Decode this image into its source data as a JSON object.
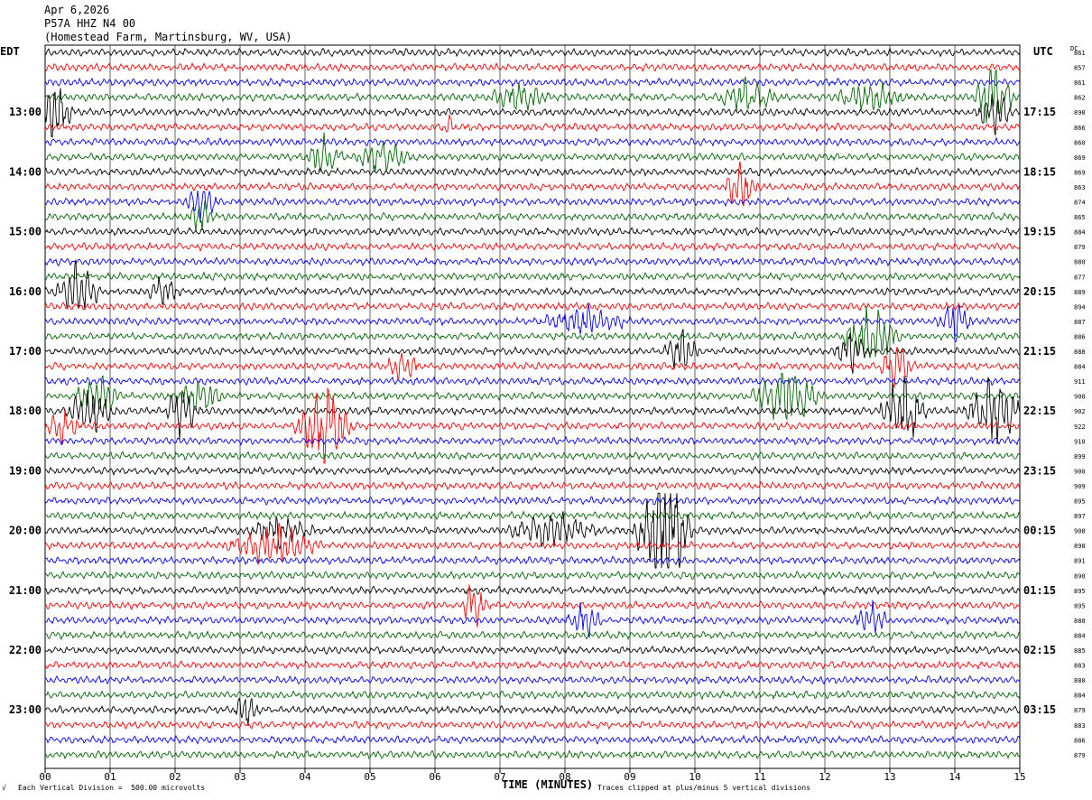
{
  "header": {
    "date": "Apr 6,2026",
    "station": "P57A HHZ N4 00",
    "location": "(Homestead Farm, Martinsburg, WV, USA)"
  },
  "left_tz": "EDT",
  "right_tz": "UTC",
  "dc_label": "DC",
  "footer": {
    "scale": "Each Vertical Division =  500.00 microvolts",
    "clip": "Traces clipped at plus/minus 5 vertical divisions",
    "mark": "√"
  },
  "colors": {
    "black": "#000000",
    "red": "#ff0000",
    "blue": "#0000ff",
    "green": "#006600",
    "grid": "#000000"
  },
  "chart_data": {
    "type": "line",
    "title": "",
    "xlabel": "TIME (MINUTES)",
    "x_ticks": [
      "00",
      "01",
      "02",
      "03",
      "04",
      "05",
      "06",
      "07",
      "08",
      "09",
      "10",
      "11",
      "12",
      "13",
      "14",
      "15"
    ],
    "xlim": [
      0,
      15
    ],
    "trace_colors": [
      "black",
      "red",
      "blue",
      "green"
    ],
    "left_hour_labels": [
      "13:00",
      "14:00",
      "15:00",
      "16:00",
      "17:00",
      "18:00",
      "19:00",
      "20:00",
      "21:00",
      "22:00",
      "23:00"
    ],
    "right_hour_labels": [
      "17:15",
      "18:15",
      "19:15",
      "20:15",
      "21:15",
      "22:15",
      "23:15",
      "00:15",
      "01:15",
      "02:15",
      "03:15"
    ],
    "dc_offsets": [
      861,
      857,
      861,
      862,
      890,
      866,
      860,
      869,
      869,
      863,
      874,
      865,
      884,
      879,
      880,
      877,
      889,
      894,
      887,
      886,
      888,
      884,
      911,
      900,
      902,
      922,
      910,
      899,
      900,
      909,
      895,
      897,
      908,
      898,
      891,
      890,
      895,
      895,
      880,
      884,
      885,
      883,
      880,
      884,
      879,
      883,
      886,
      879
    ],
    "events": [
      {
        "row": 3,
        "minute": 14.6,
        "amp": 2.2,
        "dur": 0.35
      },
      {
        "row": 3,
        "minute": 10.8,
        "amp": 1.1,
        "dur": 0.5
      },
      {
        "row": 3,
        "minute": 7.3,
        "amp": 1.0,
        "dur": 0.5
      },
      {
        "row": 3,
        "minute": 12.7,
        "amp": 1.0,
        "dur": 0.6
      },
      {
        "row": 4,
        "minute": 0.15,
        "amp": 2.0,
        "dur": 0.3
      },
      {
        "row": 4,
        "minute": 14.6,
        "amp": 1.3,
        "dur": 0.3
      },
      {
        "row": 5,
        "minute": 6.2,
        "amp": 1.0,
        "dur": 0.1
      },
      {
        "row": 7,
        "minute": 4.3,
        "amp": 1.3,
        "dur": 0.3
      },
      {
        "row": 7,
        "minute": 5.2,
        "amp": 1.0,
        "dur": 0.5
      },
      {
        "row": 9,
        "minute": 10.7,
        "amp": 1.6,
        "dur": 0.3
      },
      {
        "row": 10,
        "minute": 2.4,
        "amp": 1.0,
        "dur": 0.3
      },
      {
        "row": 11,
        "minute": 2.4,
        "amp": 1.1,
        "dur": 0.2
      },
      {
        "row": 16,
        "minute": 0.5,
        "amp": 1.8,
        "dur": 0.4
      },
      {
        "row": 16,
        "minute": 1.8,
        "amp": 0.9,
        "dur": 0.3
      },
      {
        "row": 18,
        "minute": 8.3,
        "amp": 0.8,
        "dur": 0.8
      },
      {
        "row": 18,
        "minute": 14.0,
        "amp": 1.3,
        "dur": 0.3
      },
      {
        "row": 19,
        "minute": 12.7,
        "amp": 2.0,
        "dur": 0.5
      },
      {
        "row": 20,
        "minute": 9.8,
        "amp": 1.5,
        "dur": 0.3
      },
      {
        "row": 20,
        "minute": 12.4,
        "amp": 1.2,
        "dur": 0.3
      },
      {
        "row": 21,
        "minute": 5.5,
        "amp": 1.1,
        "dur": 0.3
      },
      {
        "row": 21,
        "minute": 13.1,
        "amp": 1.6,
        "dur": 0.3
      },
      {
        "row": 23,
        "minute": 11.4,
        "amp": 2.0,
        "dur": 0.6
      },
      {
        "row": 23,
        "minute": 0.8,
        "amp": 1.4,
        "dur": 0.4
      },
      {
        "row": 23,
        "minute": 2.4,
        "amp": 1.1,
        "dur": 0.4
      },
      {
        "row": 24,
        "minute": 0.7,
        "amp": 1.5,
        "dur": 0.4
      },
      {
        "row": 24,
        "minute": 2.1,
        "amp": 1.6,
        "dur": 0.3
      },
      {
        "row": 24,
        "minute": 13.2,
        "amp": 2.6,
        "dur": 0.4
      },
      {
        "row": 24,
        "minute": 14.6,
        "amp": 2.2,
        "dur": 0.5
      },
      {
        "row": 25,
        "minute": 4.3,
        "amp": 2.8,
        "dur": 0.5
      },
      {
        "row": 25,
        "minute": 0.2,
        "amp": 1.2,
        "dur": 0.4
      },
      {
        "row": 32,
        "minute": 9.5,
        "amp": 5.0,
        "dur": 0.5
      },
      {
        "row": 32,
        "minute": 7.8,
        "amp": 1.1,
        "dur": 0.8
      },
      {
        "row": 32,
        "minute": 3.6,
        "amp": 0.9,
        "dur": 0.6
      },
      {
        "row": 33,
        "minute": 3.5,
        "amp": 1.3,
        "dur": 0.8
      },
      {
        "row": 37,
        "minute": 6.6,
        "amp": 1.7,
        "dur": 0.2
      },
      {
        "row": 38,
        "minute": 8.3,
        "amp": 1.0,
        "dur": 0.3
      },
      {
        "row": 38,
        "minute": 12.7,
        "amp": 1.0,
        "dur": 0.3
      },
      {
        "row": 44,
        "minute": 3.1,
        "amp": 1.1,
        "dur": 0.2
      }
    ]
  }
}
